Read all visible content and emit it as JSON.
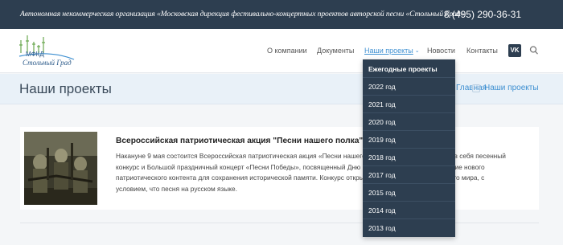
{
  "topbar": {
    "org_name": "Автономная некоммерческая организация «Московская дирекция фестивально-концертных проектов авторской песни «Стольный Град»",
    "phone": "8 (495) 290-36-31"
  },
  "logo": {
    "abbr": "МФКД",
    "name": "Стольный Град"
  },
  "nav": {
    "items": [
      {
        "label": "О компании"
      },
      {
        "label": "Документы"
      },
      {
        "label": "Наши проекты"
      },
      {
        "label": "Новости"
      },
      {
        "label": "Контакты"
      }
    ],
    "social_label": "VK",
    "icons": {
      "social": "vk-icon",
      "search": "search-icon",
      "dropdown": "chevron-down-icon"
    }
  },
  "dropdown": {
    "items": [
      {
        "label": "Ежегодные проекты"
      },
      {
        "label": "2022 год"
      },
      {
        "label": "2021 год"
      },
      {
        "label": "2020 год"
      },
      {
        "label": "2019 год"
      },
      {
        "label": "2018 год"
      },
      {
        "label": "2017 год"
      },
      {
        "label": "2015 год"
      },
      {
        "label": "2014 год"
      },
      {
        "label": "2013 год"
      }
    ]
  },
  "page": {
    "title": "Наши проекты",
    "breadcrumb": {
      "home": "Главная",
      "current": "Наши проекты"
    }
  },
  "article": {
    "title": "Всероссийская патриотическая акция \"Песни нашего полка\"",
    "lines": [
      "Накануне 9 мая состоится Всероссийская патриотическая акция «Песни нашего полка», которая объединит в себя песенный",
      "конкурс и Большой праздничный концерт «Песни Победы», посвященный Дню Победы. Цель акции – создание нового",
      "патриотического контента для сохранения исторической памяти. Конкурс открыт для всех участников со всего мира, с",
      "условием, что песня на русском языке."
    ]
  },
  "colors": {
    "topbar_bg": "#2d3e50",
    "accent": "#3d8fd1",
    "title_bar_bg": "#e9f1f8",
    "dropdown_bg": "#2d3e50"
  }
}
